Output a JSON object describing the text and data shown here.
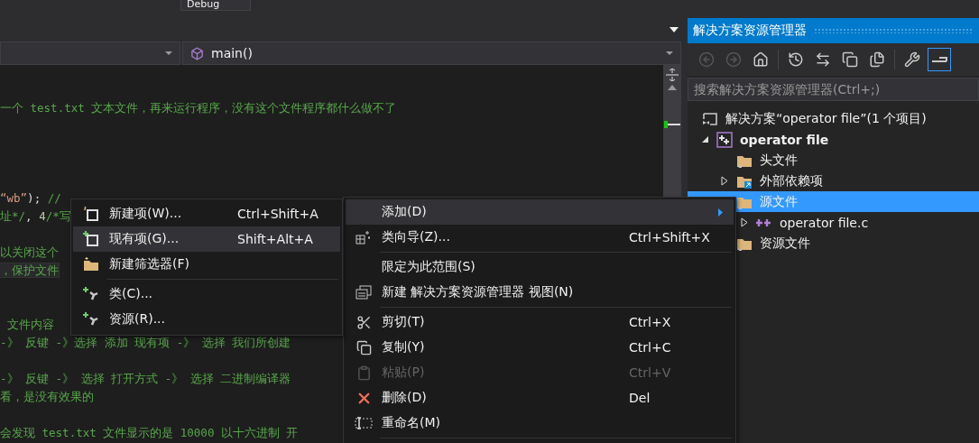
{
  "toolbar": {
    "configuration": "Debug"
  },
  "editor": {
    "navigation": {
      "scope": "main()"
    },
    "lines": [
      {
        "kind": "blank",
        "highlighted": false
      },
      {
        "kind": "code",
        "highlighted": false,
        "segments": [
          {
            "kind": "comment",
            "text": "一个 test.txt 文本文件，再来运行程序，没有这个文件程序都什么做不了"
          }
        ]
      },
      {
        "kind": "blank",
        "highlighted": false
      },
      {
        "kind": "blank",
        "highlighted": false
      },
      {
        "kind": "blank",
        "highlighted": false
      },
      {
        "kind": "blank",
        "highlighted": false
      },
      {
        "kind": "code",
        "highlighted": false,
        "segments": [
          {
            "kind": "string",
            "text": "“wb”"
          },
          {
            "kind": "plain",
            "text": ");"
          },
          {
            "kind": "comment",
            "text": " //"
          }
        ]
      },
      {
        "kind": "code",
        "highlighted": false,
        "segments": [
          {
            "kind": "comment",
            "text": "址*/"
          },
          {
            "kind": "plain",
            "text": ", "
          },
          {
            "kind": "number",
            "text": "4"
          },
          {
            "kind": "comment",
            "text": "/*写"
          }
        ]
      },
      {
        "kind": "blank",
        "highlighted": false
      },
      {
        "kind": "code",
        "highlighted": false,
        "segments": [
          {
            "kind": "comment",
            "text": "以关闭这个"
          }
        ]
      },
      {
        "kind": "code",
        "highlighted": true,
        "segments": [
          {
            "kind": "comment",
            "text": "，保护文件"
          }
        ]
      },
      {
        "kind": "blank",
        "highlighted": false
      },
      {
        "kind": "blank",
        "highlighted": false
      },
      {
        "kind": "code",
        "highlighted": false,
        "segments": [
          {
            "kind": "comment",
            "text": " 文件内容"
          }
        ]
      },
      {
        "kind": "code",
        "highlighted": false,
        "segments": [
          {
            "kind": "comment",
            "text": "-》 反键 -》选择 添加 现有项 -》 选择 我们所创建"
          }
        ]
      },
      {
        "kind": "blank",
        "highlighted": false
      },
      {
        "kind": "code",
        "highlighted": false,
        "segments": [
          {
            "kind": "comment",
            "text": "-》 反键 -》 选择 打开方式 -》 选择 二进制编译器"
          }
        ]
      },
      {
        "kind": "code",
        "highlighted": false,
        "segments": [
          {
            "kind": "comment",
            "text": "看，是没有效果的"
          }
        ]
      },
      {
        "kind": "blank",
        "highlighted": false
      },
      {
        "kind": "code",
        "highlighted": false,
        "segments": [
          {
            "kind": "comment",
            "text": "会发现 test.txt 文件显示的是 10000 以十六进制 开"
          }
        ]
      }
    ]
  },
  "solution_explorer": {
    "title": "解决方案资源管理器",
    "toolbar": [
      {
        "disabled": true,
        "selected": false
      },
      {
        "disabled": true,
        "selected": false
      },
      {
        "disabled": false,
        "selected": false
      },
      {
        "disabled": false,
        "selected": false
      },
      {
        "disabled": false,
        "selected": false
      },
      {
        "disabled": false,
        "selected": false
      },
      {
        "disabled": false,
        "selected": false
      },
      {
        "disabled": false,
        "selected": false
      },
      {
        "disabled": false,
        "selected": true
      }
    ],
    "search": {
      "placeholder": "搜索解决方案资源管理器(Ctrl+;)"
    },
    "tree": [
      {
        "kind": "solution",
        "label": "解决方案“operator file”(1 个项目)",
        "selected": false,
        "children": [
          {
            "kind": "project",
            "label": "operator file",
            "expanded": true,
            "selected": false,
            "children": [
              {
                "kind": "folder",
                "label": "头文件",
                "selected": false
              },
              {
                "kind": "references",
                "label": "外部依赖项",
                "expanded": false,
                "selected": false
              },
              {
                "kind": "folder",
                "label": "源文件",
                "selected": true,
                "children": [
                  {
                    "kind": "file",
                    "label": "operator file.c",
                    "expanded": false,
                    "selected": false
                  }
                ]
              },
              {
                "kind": "folder",
                "label": "资源文件",
                "selected": false
              }
            ]
          }
        ]
      }
    ]
  },
  "context_menu": {
    "items": [
      {
        "kind": "item",
        "label": "添加(D)",
        "selected": true,
        "disabled": false,
        "submenu": true
      },
      {
        "kind": "item",
        "label": "类向导(Z)...",
        "shortcut": "Ctrl+Shift+X",
        "selected": false,
        "disabled": false,
        "submenu": false
      },
      {
        "kind": "separator"
      },
      {
        "kind": "item",
        "label": "限定为此范围(S)",
        "selected": false,
        "disabled": false,
        "submenu": false
      },
      {
        "kind": "item",
        "label": "新建 解决方案资源管理器 视图(N)",
        "selected": false,
        "disabled": false,
        "submenu": false
      },
      {
        "kind": "separator"
      },
      {
        "kind": "item",
        "label": "剪切(T)",
        "shortcut": "Ctrl+X",
        "selected": false,
        "disabled": false,
        "submenu": false
      },
      {
        "kind": "item",
        "label": "复制(Y)",
        "shortcut": "Ctrl+C",
        "selected": false,
        "disabled": false,
        "submenu": false
      },
      {
        "kind": "item",
        "label": "粘贴(P)",
        "shortcut": "Ctrl+V",
        "selected": false,
        "disabled": true,
        "submenu": false
      },
      {
        "kind": "item",
        "label": "删除(D)",
        "shortcut": "Del",
        "selected": false,
        "disabled": false,
        "submenu": false
      },
      {
        "kind": "item",
        "label": "重命名(M)",
        "selected": false,
        "disabled": false,
        "submenu": false
      },
      {
        "kind": "separator"
      }
    ]
  },
  "submenu": {
    "items": [
      {
        "kind": "item",
        "label": "新建项(W)...",
        "shortcut": "Ctrl+Shift+A",
        "selected": false,
        "disabled": false
      },
      {
        "kind": "item",
        "label": "现有项(G)...",
        "shortcut": "Shift+Alt+A",
        "selected": true,
        "disabled": false
      },
      {
        "kind": "item",
        "label": "新建筛选器(F)",
        "selected": false,
        "disabled": false
      },
      {
        "kind": "separator"
      },
      {
        "kind": "item",
        "label": "类(C)...",
        "selected": false,
        "disabled": false
      },
      {
        "kind": "item",
        "label": "资源(R)...",
        "selected": false,
        "disabled": false
      }
    ]
  }
}
